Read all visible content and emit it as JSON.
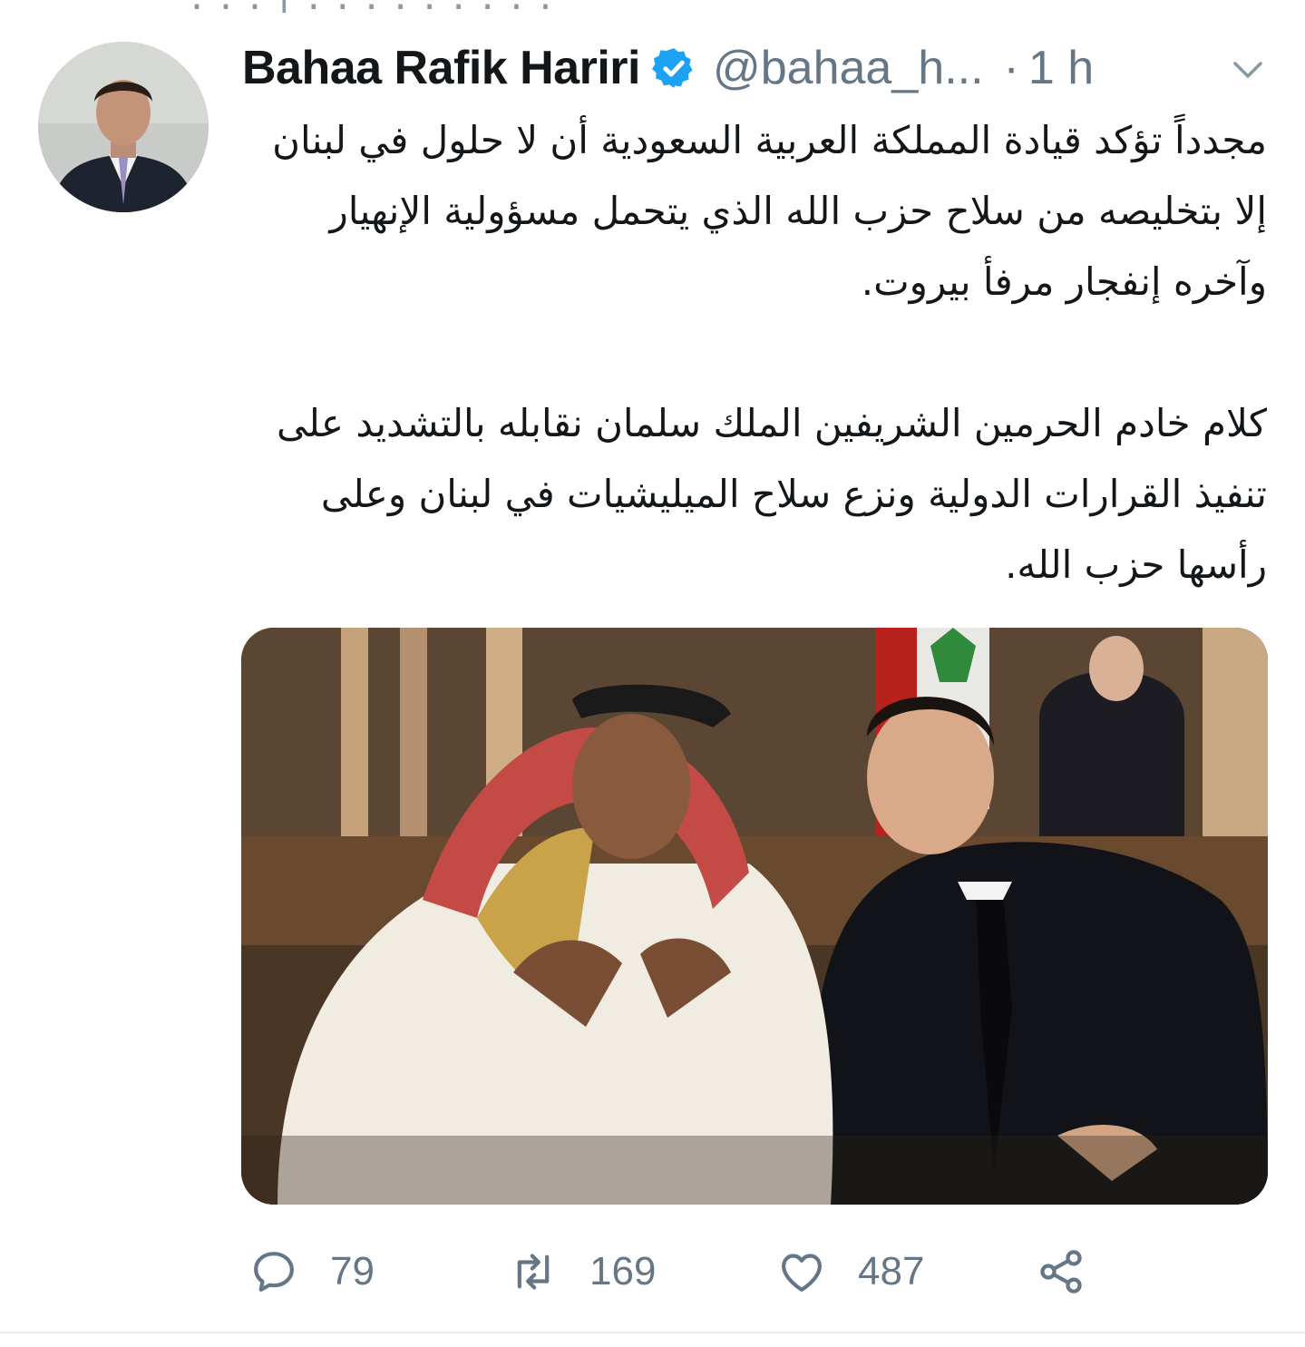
{
  "tweet": {
    "author_name": "Bahaa Rafik Hariri",
    "handle": "@bahaa_h...",
    "separator": "·",
    "time": "1 h",
    "paragraphs": [
      "مجدداً تؤكد قيادة المملكة العربية السعودية أن لا حلول في لبنان إلا بتخليصه من سلاح حزب الله الذي يتحمل مسؤولية الإنهيار وآخره إنفجار مرفأ بيروت.",
      "كلام خادم الحرمين الشريفين الملك سلمان نقابله بالتشديد على تنفيذ القرارات الدولية ونزع سلاح الميليشيات في لبنان وعلى رأسها حزب الله."
    ],
    "actions": {
      "replies": "79",
      "retweets": "169",
      "likes": "487"
    }
  },
  "icons": {
    "verified": "verified-badge-icon",
    "caret": "chevron-down-icon",
    "reply": "speech-bubble-icon",
    "retweet": "retweet-arrows-icon",
    "like": "heart-icon",
    "share": "share-icon"
  },
  "colors": {
    "verified_blue": "#1da1f2",
    "secondary_text": "#657786",
    "primary_text": "#14171a",
    "divider": "#e6ecf0"
  }
}
